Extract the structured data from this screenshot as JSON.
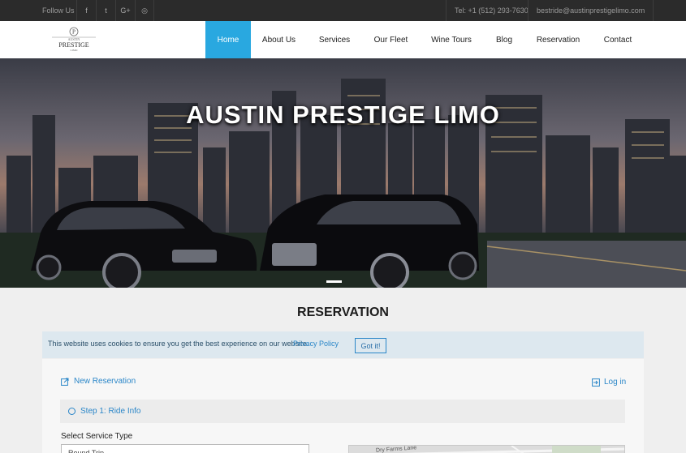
{
  "topbar": {
    "follow_label": "Follow Us",
    "social_icons": [
      "facebook-icon",
      "twitter-icon",
      "google-plus-icon",
      "instagram-icon"
    ],
    "social_glyphs": [
      "f",
      "t",
      "G+",
      "◎"
    ],
    "phone": "Tel: +1 (512) 293-7630",
    "email": "bestride@austinprestigelimo.com"
  },
  "logo": {
    "line1": "AUSTIN",
    "line2": "PRESTIGE",
    "line3": "LIMO",
    "monogram": "P"
  },
  "nav": {
    "items": [
      {
        "label": "Home",
        "active": true
      },
      {
        "label": "About Us",
        "active": false
      },
      {
        "label": "Services",
        "active": false
      },
      {
        "label": "Our Fleet",
        "active": false
      },
      {
        "label": "Wine Tours",
        "active": false
      },
      {
        "label": "Blog",
        "active": false
      },
      {
        "label": "Reservation",
        "active": false
      },
      {
        "label": "Contact",
        "active": false
      }
    ]
  },
  "hero": {
    "title": "AUSTIN PRESTIGE LIMO"
  },
  "reservation": {
    "heading": "RESERVATION",
    "new_reservation": "New Reservation",
    "login": "Log in",
    "step1": "Step 1: Ride Info",
    "service_type_label": "Select Service Type",
    "service_type_value": "Round Trip",
    "map_label": "Dry Farms Lane"
  },
  "cookie": {
    "text": "This website uses cookies to ensure you get the best experience on our website.",
    "link": "Privacy Policy",
    "button": "Got it!"
  },
  "colors": {
    "accent": "#29a8e0",
    "link": "#2a86c8",
    "topbar_bg": "#2b2b2b",
    "page_bg": "#efefef"
  }
}
